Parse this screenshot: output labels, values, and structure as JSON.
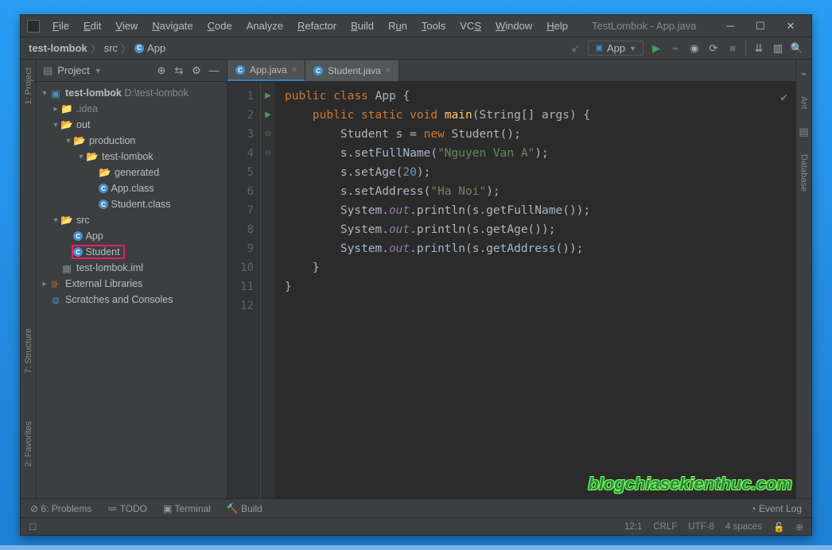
{
  "window": {
    "title": "TestLombok - App.java"
  },
  "menu": {
    "file": "File",
    "edit": "Edit",
    "view": "View",
    "navigate": "Navigate",
    "code": "Code",
    "analyze": "Analyze",
    "refactor": "Refactor",
    "build": "Build",
    "run": "Run",
    "tools": "Tools",
    "vcs": "VCS",
    "window_m": "Window",
    "help": "Help"
  },
  "breadcrumb": {
    "root": "test-lombok",
    "mid": "src",
    "leaf": "App"
  },
  "runConfig": {
    "name": "App"
  },
  "projectPanel": {
    "title": "Project",
    "tree": {
      "root": "test-lombok",
      "rootPath": "D:\\test-lombok",
      "idea": ".idea",
      "out": "out",
      "production": "production",
      "tl": "test-lombok",
      "generated": "generated",
      "appClass": "App.class",
      "studentClass": "Student.class",
      "src": "src",
      "app": "App",
      "student": "Student",
      "iml": "test-lombok.iml",
      "ext": "External Libraries",
      "scratches": "Scratches and Consoles"
    }
  },
  "tabs": {
    "app": "App.java",
    "student": "Student.java"
  },
  "code": {
    "l1a": "public",
    "l1b": "class",
    "l1c": "App",
    "l1d": "{",
    "l2a": "public static",
    "l2b": "void",
    "l2c": "main",
    "l2d": "(String[] args) {",
    "l3a": "Student s = ",
    "l3b": "new",
    "l3c": " Student();",
    "l4a": "s.setFullName(",
    "l4b": "\"Nguyen Van A\"",
    "l4c": ");",
    "l5a": "s.setAge(",
    "l5b": "20",
    "l5c": ");",
    "l6a": "s.setAddress(",
    "l6b": "\"Ha Noi\"",
    "l6c": ");",
    "l7a": "System.",
    "l7b": "out",
    "l7c": ".println(s.getFullName());",
    "l8a": "System.",
    "l8b": "out",
    "l8c": ".println(s.getAge());",
    "l9a": "System.",
    "l9b": "out",
    "l9c": ".println(s.getAddress());",
    "l10": "}",
    "l11": "}"
  },
  "leftGutter": {
    "project": "1: Project",
    "structure": "7: Structure",
    "favorites": "2: Favorites"
  },
  "rightGutter": {
    "ant": "Ant",
    "database": "Database"
  },
  "bottom": {
    "problems": "6: Problems",
    "todo": "TODO",
    "terminal": "Terminal",
    "build": "Build",
    "eventLog": "Event Log"
  },
  "status": {
    "caret": "12:1",
    "lineSep": "CRLF",
    "encoding": "UTF-8",
    "indent": "4 spaces"
  },
  "watermark": "blogchiasekienthuc.com"
}
